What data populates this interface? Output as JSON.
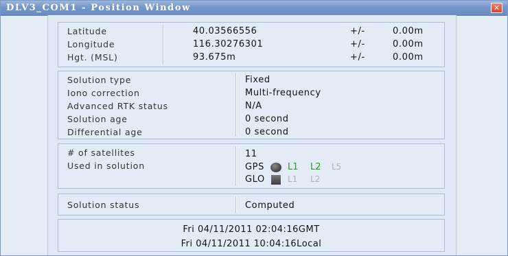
{
  "window": {
    "title": "DLV3_COM1 - Position Window",
    "close_symbol": "✕"
  },
  "position": {
    "rows": [
      {
        "label": "Latitude",
        "value": "40.03566556",
        "pm": "+/-",
        "err": "0.00m"
      },
      {
        "label": "Longitude",
        "value": "116.30276301",
        "pm": "+/-",
        "err": "0.00m"
      },
      {
        "label": "Hgt. (MSL)",
        "value": "93.675m",
        "pm": "+/-",
        "err": "0.00m"
      }
    ]
  },
  "solution": {
    "rows": [
      {
        "label": "Solution type",
        "value": "Fixed"
      },
      {
        "label": "Iono correction",
        "value": "Multi-frequency"
      },
      {
        "label": "Advanced RTK status",
        "value": "N/A"
      },
      {
        "label": "Solution age",
        "value": "0 second"
      },
      {
        "label": "Differential age",
        "value": "0 second"
      }
    ]
  },
  "satellites": {
    "count_label": "# of satellites",
    "count_value": "11",
    "used_label": "Used in solution",
    "gps": {
      "name": "GPS",
      "icon": "gps-satellite-icon",
      "bands": [
        {
          "label": "L1",
          "active": true
        },
        {
          "label": "L2",
          "active": true
        },
        {
          "label": "L5",
          "active": false
        }
      ]
    },
    "glo": {
      "name": "GLO",
      "icon": "glonass-satellite-icon",
      "bands": [
        {
          "label": "L1",
          "active": false
        },
        {
          "label": "L2",
          "active": false
        }
      ]
    }
  },
  "status": {
    "label": "Solution status",
    "value": "Computed"
  },
  "time": {
    "gmt": "Fri 04/11/2011 02:04:16GMT",
    "local": "Fri 04/11/2011 10:04:16Local"
  },
  "colors": {
    "band_active": "#2f9b1f",
    "band_inactive": "#a6b2bf",
    "title_bar": "#7596c8",
    "panel_bg": "#e3ecf6"
  }
}
